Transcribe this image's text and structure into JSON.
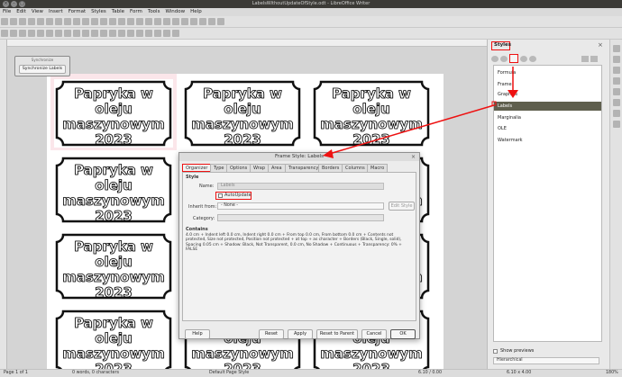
{
  "window": {
    "title": "LabelsWithoutUpdateOfStyle.odt - LibreOffice Writer"
  },
  "menu": [
    "File",
    "Edit",
    "View",
    "Insert",
    "Format",
    "Styles",
    "Table",
    "Form",
    "Tools",
    "Window",
    "Help"
  ],
  "sync_window": {
    "title": "Synchronize",
    "button": "Synchronize Labels"
  },
  "label_text": "Papryka w oleju maszynowym 2023",
  "sidebar": {
    "title": "Styles",
    "items": [
      "Formula",
      "Frame",
      "Graphics",
      "Labels",
      "Marginalia",
      "OLE",
      "Watermark"
    ],
    "selected": "Labels",
    "show_previews": "Show previews",
    "filter": "Hierarchical"
  },
  "dialog": {
    "title": "Frame Style: Labels",
    "tabs": [
      "Organizer",
      "Type",
      "Options",
      "Wrap",
      "Area",
      "Transparency",
      "Borders",
      "Columns",
      "Macro"
    ],
    "style_heading": "Style",
    "name_label": "Name:",
    "name_value": "Labels",
    "autoupdate_label": "AutoUpdate",
    "inherit_label": "Inherit from:",
    "inherit_value": "- None -",
    "edit_style": "Edit Style",
    "category_label": "Category:",
    "contains_heading": "Contains",
    "contains_text": "4.0 cm + Indent left 0.0 cm, Indent right 0.0 cm + From top 0.0 cm, From bottom 0.0 cm + Contents not protected, Size not protected, Position not protected + at top + as character + Borders (Black, Single, solid), Spacing 0.05 cm + Shadow: Black, Not Transparent, 0.0 cm, No Shadow + Continuous + Transparency: 0% + FALSE",
    "buttons": {
      "help": "Help",
      "reset": "Reset",
      "apply": "Apply",
      "reset_parent": "Reset to Parent",
      "cancel": "Cancel",
      "ok": "OK"
    }
  },
  "status": {
    "page": "Page 1 of 1",
    "words": "0 words, 0 characters",
    "page_style": "Default Page Style",
    "position": "6.10 / 0.00",
    "size": "6.10 x 4.00",
    "zoom": "180%"
  },
  "colors": {
    "accent_red": "#e11111",
    "selected_row": "#5f5f4e"
  }
}
